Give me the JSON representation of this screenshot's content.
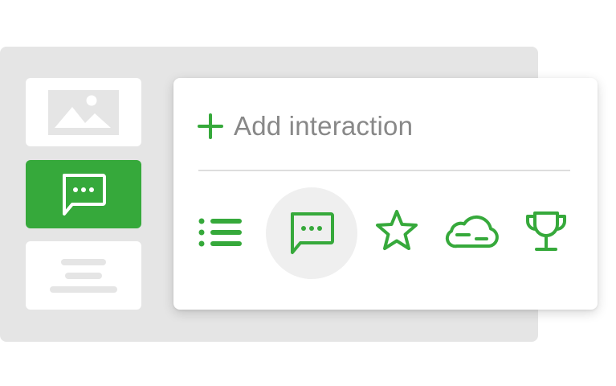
{
  "accent_color": "#36a93b",
  "sidebar": {
    "items": [
      {
        "name": "image-block",
        "icon": "image-icon"
      },
      {
        "name": "interaction-block",
        "icon": "chat-bubble-icon",
        "active": true
      },
      {
        "name": "text-block",
        "icon": "text-lines-icon"
      }
    ]
  },
  "popup": {
    "add_icon": "plus-icon",
    "add_label": "Add interaction",
    "interaction_types": [
      {
        "name": "list",
        "icon": "bulleted-list-icon"
      },
      {
        "name": "comment",
        "icon": "chat-bubble-icon",
        "selected": true
      },
      {
        "name": "rating",
        "icon": "star-icon"
      },
      {
        "name": "cloud",
        "icon": "cloud-icon"
      },
      {
        "name": "trophy",
        "icon": "trophy-icon"
      }
    ]
  }
}
